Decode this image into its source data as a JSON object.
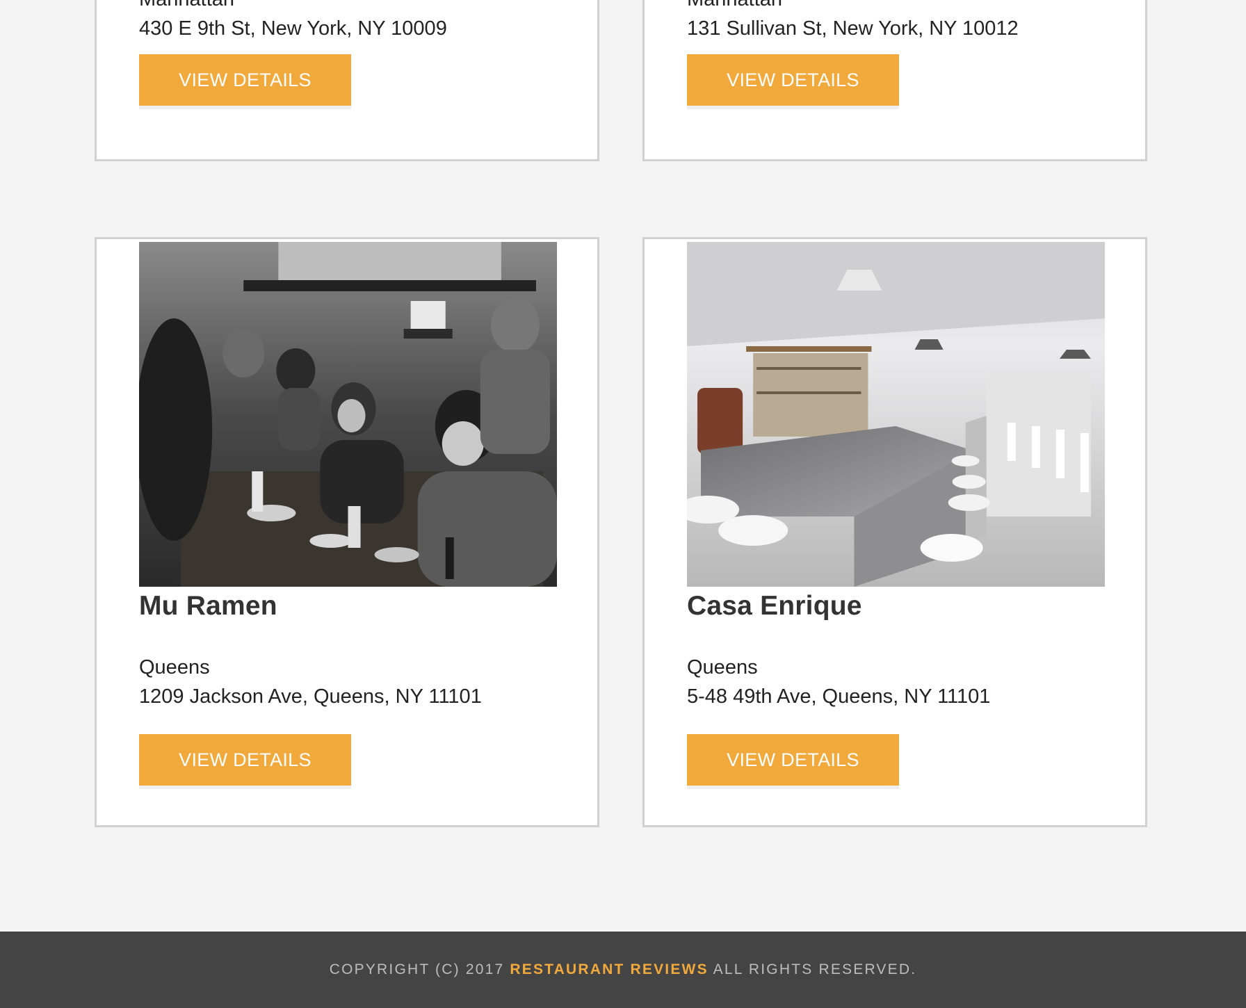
{
  "colors": {
    "page_background": "#f3f3f3",
    "card_border": "#d1d1d1",
    "button_background": "#f2a93b",
    "button_text": "#ffffff",
    "footer_background": "#444444",
    "footer_text": "#bdbdbd",
    "footer_brand": "#f2a93b"
  },
  "restaurants": [
    {
      "neighborhood": "Manhattan",
      "address": "430 E 9th St, New York, NY 10009",
      "button_label": "VIEW DETAILS"
    },
    {
      "neighborhood": "Manhattan",
      "address": "131 Sullivan St, New York, NY 10012",
      "button_label": "VIEW DETAILS"
    },
    {
      "name": "Mu Ramen",
      "photo": "ramen-diners-photo",
      "neighborhood": "Queens",
      "address": "1209 Jackson Ave, Queens, NY 11101",
      "button_label": "VIEW DETAILS"
    },
    {
      "name": "Casa Enrique",
      "photo": "restaurant-bar-interior-photo",
      "neighborhood": "Queens",
      "address": "5-48 49th Ave, Queens, NY 11101",
      "button_label": "VIEW DETAILS"
    }
  ],
  "footer": {
    "prefix": "COPYRIGHT (C) 2017",
    "brand": "RESTAURANT REVIEWS",
    "suffix": "ALL RIGHTS RESERVED."
  }
}
